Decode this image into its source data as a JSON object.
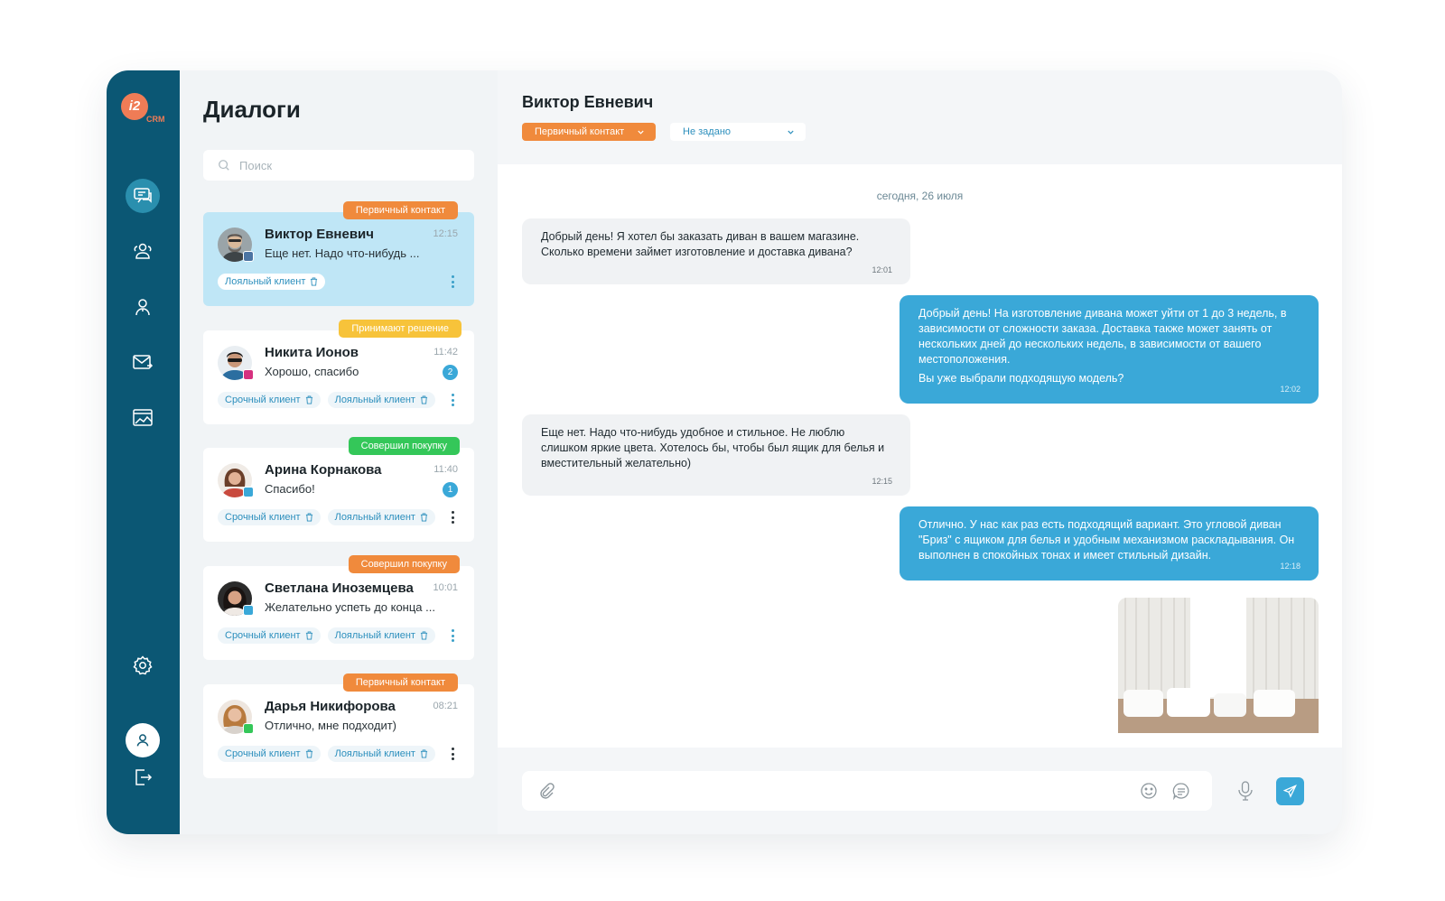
{
  "app": {
    "logo": {
      "mark": "i2",
      "sub": "CRM",
      "color": "#ef7c56"
    },
    "sidebar_icons": [
      "chat-icon",
      "users-icon",
      "user-icon",
      "mail-icon",
      "gallery-icon",
      "settings-icon",
      "profile-icon",
      "logout-icon"
    ]
  },
  "dialogs": {
    "title": "Диалоги",
    "search_placeholder": "Поиск",
    "items": [
      {
        "tag": "Первичный контакт",
        "tag_color": "#f08a3c",
        "name": "Виктор Евневич",
        "time": "12:15",
        "preview": "Еще нет. Надо что-нибудь ...",
        "chips": [
          "Лояльный клиент"
        ],
        "channel": "vk-icon"
      },
      {
        "tag": "Принимают решение",
        "tag_color": "#f7c33a",
        "name": "Никита Ионов",
        "time": "11:42",
        "preview": "Хорошо, спасибо",
        "unread": "2",
        "chips": [
          "Срочный клиент",
          "Лояльный клиент"
        ],
        "channel": "instagram-icon"
      },
      {
        "tag": "Совершил покупку",
        "tag_color": "#34c759",
        "name": "Арина Корнакова",
        "time": "11:40",
        "preview": "Спасибо!",
        "unread": "1",
        "chips": [
          "Срочный клиент",
          "Лояльный клиент"
        ],
        "channel": "telegram-icon"
      },
      {
        "tag": "Совершил покупку",
        "tag_color": "#f08a3c",
        "name": "Светлана Иноземцева",
        "time": "10:01",
        "preview": "Желательно успеть до конца ...",
        "chips": [
          "Срочный клиент",
          "Лояльный клиент"
        ],
        "channel": "telegram-icon"
      },
      {
        "tag": "Первичный контакт",
        "tag_color": "#f08a3c",
        "name": "Дарья Никифорова",
        "time": "08:21",
        "preview": "Отлично, мне подходит)",
        "chips": [
          "Срочный клиент",
          "Лояльный клиент"
        ],
        "channel": "whatsapp-icon"
      }
    ]
  },
  "chat": {
    "contact_name": "Виктор Евневич",
    "status": "Первичный контакт",
    "assignee": "Не задано",
    "date": "сегодня, 26 июля",
    "messages": [
      {
        "dir": "in",
        "lines": [
          "Добрый день! Я хотел бы заказать диван в вашем магазине. Сколько времени займет изготовление и доставка дивана?"
        ],
        "time": "12:01"
      },
      {
        "dir": "out",
        "lines": [
          "Добрый день! На изготовление дивана может уйти от 1 до 3 недель, в зависимости от сложности заказа. Доставка также может занять от нескольких дней до нескольких недель, в зависимости от вашего местоположения.",
          "Вы уже выбрали подходящую модель?"
        ],
        "time": "12:02"
      },
      {
        "dir": "in",
        "lines": [
          "Еще нет. Надо что-нибудь удобное и стильное. Не люблю слишком яркие цвета. Хотелось бы, чтобы был ящик для белья и вместительный желательно)"
        ],
        "time": "12:15"
      },
      {
        "dir": "out",
        "lines": [
          "Отлично. У нас как раз есть подходящий вариант. Это угловой диван \"Бриз\" с ящиком для белья и удобным механизмом раскладывания. Он выполнен в спокойных тонах и имеет стильный дизайн."
        ],
        "time": "12:18"
      }
    ],
    "composer_placeholder": ""
  },
  "colors": {
    "sidebar": "#0b5774",
    "accent": "#3aa8d8",
    "orange": "#f08a3c",
    "active_card": "#bfe6f6"
  }
}
